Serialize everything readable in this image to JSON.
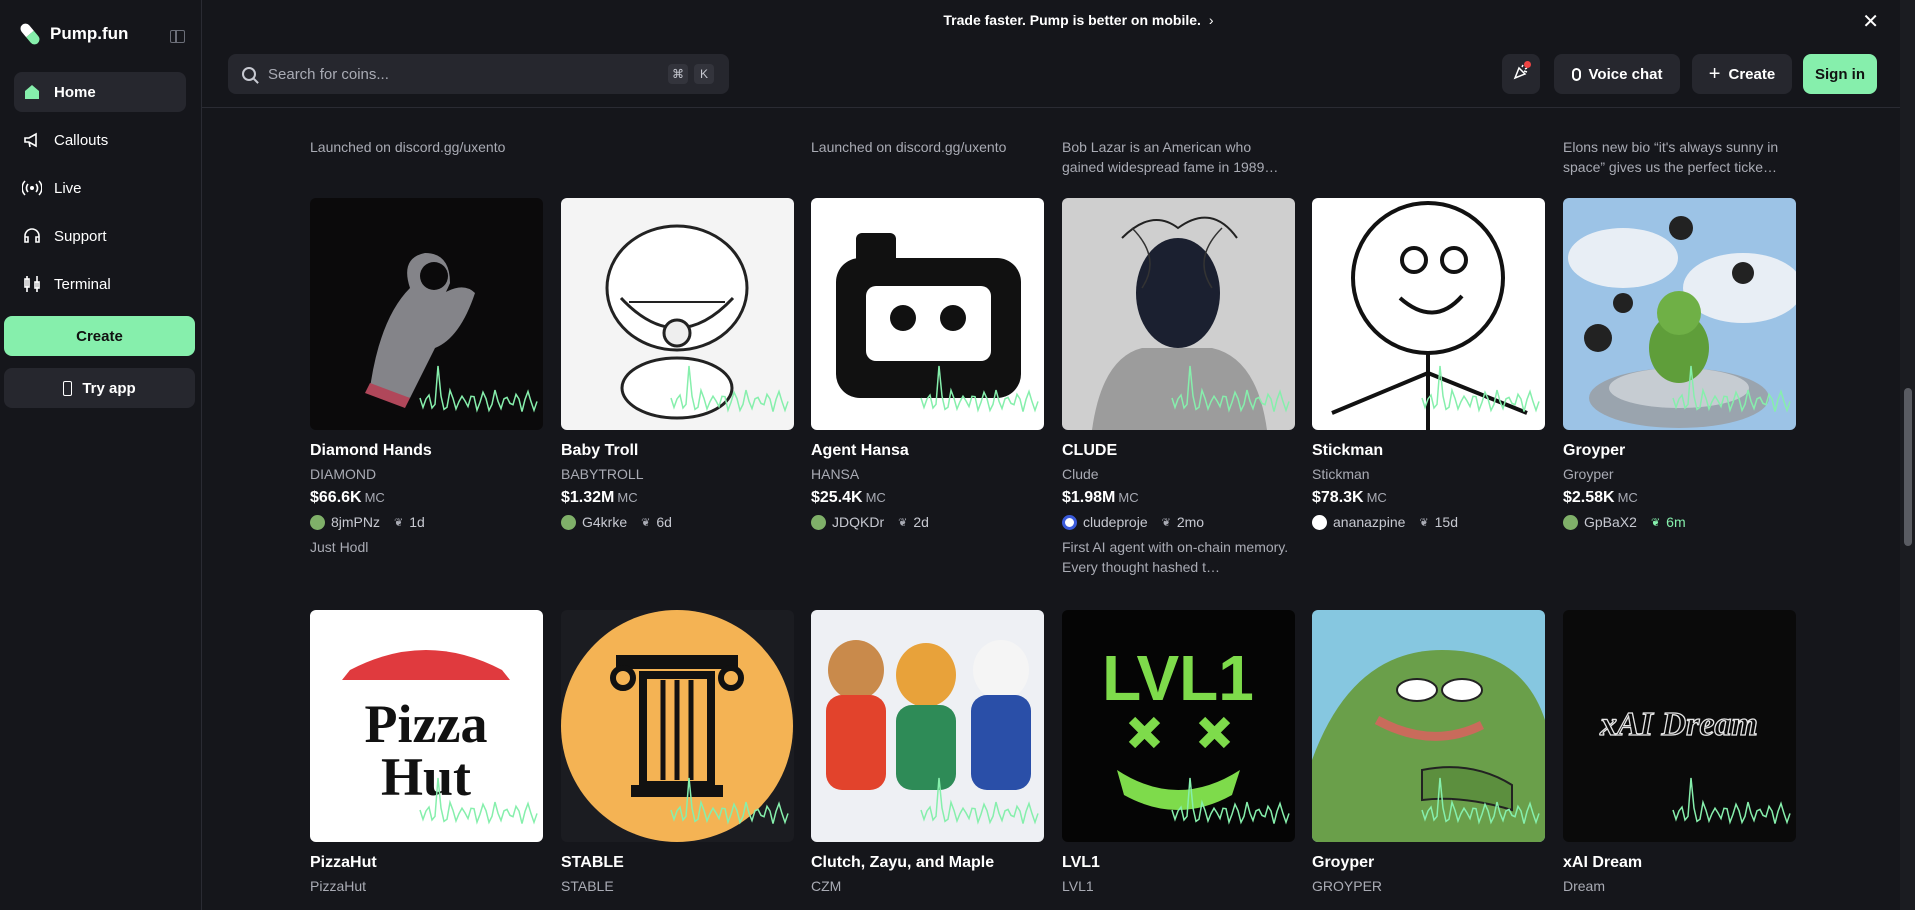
{
  "brand": {
    "name": "Pump.fun"
  },
  "sidebar": {
    "items": [
      {
        "label": "Home",
        "icon": "home-icon",
        "active": true
      },
      {
        "label": "Callouts",
        "icon": "megaphone-icon"
      },
      {
        "label": "Live",
        "icon": "broadcast-icon"
      },
      {
        "label": "Support",
        "icon": "headset-icon"
      },
      {
        "label": "Terminal",
        "icon": "candles-icon"
      }
    ],
    "create_label": "Create",
    "tryapp_label": "Try app"
  },
  "banner": {
    "text": "Trade faster. Pump is better on mobile."
  },
  "header": {
    "search_placeholder": "Search for coins...",
    "kbd_cmd": "⌘",
    "kbd_k": "K",
    "voice_label": "Voice chat",
    "create_label": "Create",
    "signin_label": "Sign in"
  },
  "colors": {
    "accent": "#86efac",
    "background": "#15161b",
    "surface": "#26272e"
  },
  "previous_row_descriptions": [
    "Launched on discord.gg/uxento",
    "",
    "Launched on discord.gg/uxento",
    "Bob Lazar is an American who gained widespread fame in 1989…",
    "",
    "Elons new bio “it's always sunny in space” gives us the perfect ticke…"
  ],
  "row1": [
    {
      "name": "Diamond Hands",
      "ticker": "DIAMOND",
      "mc": "$66.6K",
      "unit": "MC",
      "creator": "8jmPNz",
      "age": "1d",
      "desc": "Just Hodl"
    },
    {
      "name": "Baby Troll",
      "ticker": "BABYTROLL",
      "mc": "$1.32M",
      "unit": "MC",
      "creator": "G4krke",
      "age": "6d",
      "desc": ""
    },
    {
      "name": "Agent Hansa",
      "ticker": "HANSA",
      "mc": "$25.4K",
      "unit": "MC",
      "creator": "JDQKDr",
      "age": "2d",
      "desc": ""
    },
    {
      "name": "CLUDE",
      "ticker": "Clude",
      "mc": "$1.98M",
      "unit": "MC",
      "creator": "cludeproje",
      "age": "2mo",
      "desc": "First AI agent with on-chain memory. Every thought hashed t…"
    },
    {
      "name": "Stickman",
      "ticker": "Stickman",
      "mc": "$78.3K",
      "unit": "MC",
      "creator": "ananazpine",
      "age": "15d",
      "desc": ""
    },
    {
      "name": "Groyper",
      "ticker": "Groyper",
      "mc": "$2.58K",
      "unit": "MC",
      "creator": "GpBaX2",
      "age": "6m",
      "desc": ""
    }
  ],
  "row2": [
    {
      "name": "PizzaHut",
      "ticker": "PizzaHut"
    },
    {
      "name": "STABLE",
      "ticker": "STABLE"
    },
    {
      "name": "Clutch, Zayu, and Maple",
      "ticker": "CZM"
    },
    {
      "name": "LVL1",
      "ticker": "LVL1"
    },
    {
      "name": "Groyper",
      "ticker": "GROYPER"
    },
    {
      "name": "xAI Dream",
      "ticker": "Dream"
    }
  ],
  "thumb_text": {
    "pizza_line1": "Pizza",
    "pizza_line2": "Hut",
    "lvl1": "LVL1",
    "xai": "xAI Dream"
  }
}
